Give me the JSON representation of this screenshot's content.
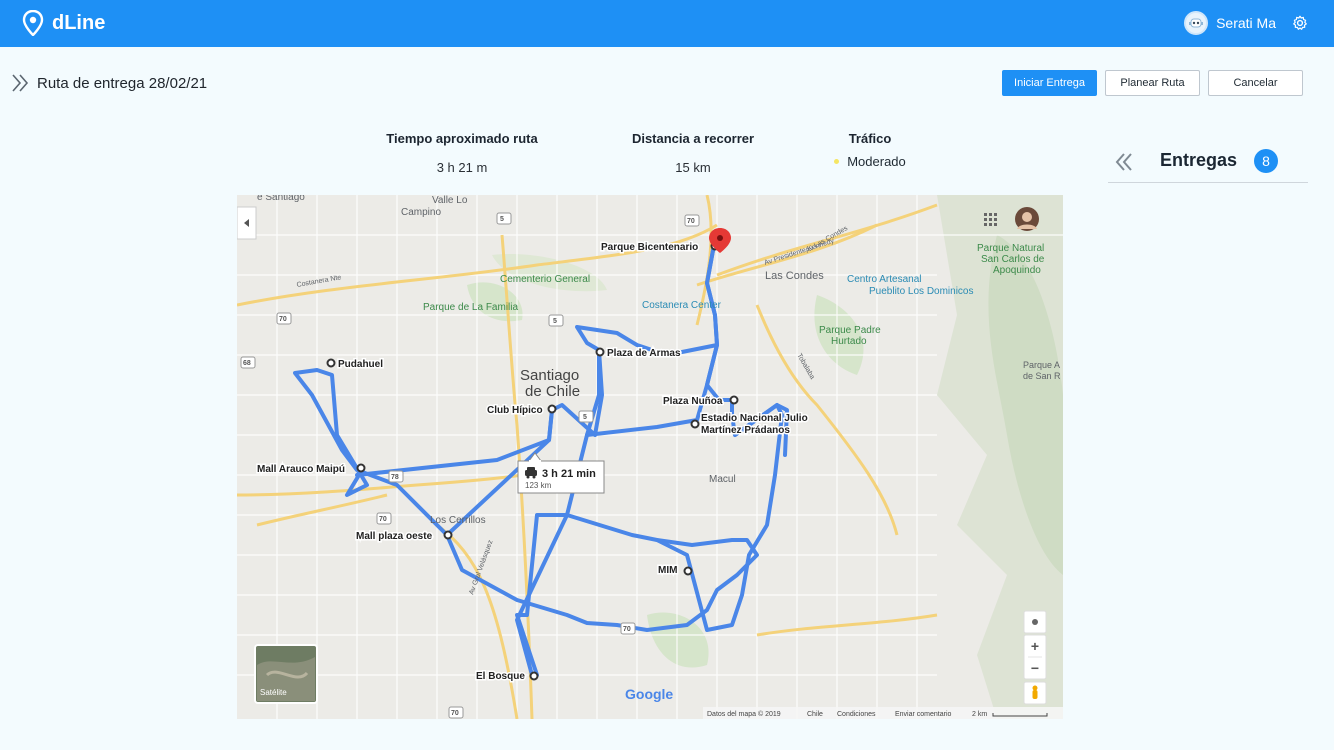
{
  "app": {
    "name": "dLine"
  },
  "user": {
    "name": "Serati Ma"
  },
  "page": {
    "title": "Ruta de entrega 28/02/21"
  },
  "actions": {
    "start": "Iniciar Entrega",
    "plan": "Planear Ruta",
    "cancel": "Cancelar"
  },
  "stats": {
    "time_label": "Tiempo aproximado ruta",
    "time_value": "3 h 21 m",
    "distance_label": "Distancia a recorrer",
    "distance_value": "15 km",
    "traffic_label": "Tráfico",
    "traffic_value": "Moderado"
  },
  "sidebar": {
    "title": "Entregas",
    "count": "8"
  },
  "map": {
    "route_badge_time": "3 h 21 min",
    "route_badge_distance": "123 km",
    "stops": [
      "Parque Bicentenario",
      "Plaza de Armas",
      "Pudahuel",
      "Club Hípico",
      "Plaza Nuñoa",
      "Estadio Nacional Julio",
      "Martínez Prádanos",
      "Mall Arauco Maipú",
      "Mall plaza oeste",
      "MIM",
      "El Bosque"
    ],
    "places": [
      "Valle Lo",
      "Campino",
      "Cementerio General",
      "Parque de La Familia",
      "Costanera Center",
      "Las Condes",
      "Centro Artesanal",
      "Pueblito Los Dominicos",
      "Parque Natural",
      "San Carlos de",
      "Apoquindo",
      "Parque Padre",
      "Hurtado",
      "Santiago",
      "de Chile",
      "Macul",
      "Los Cerrillos",
      "Av Presidente Kennedy",
      "Av Las Condes",
      "Costanera Nte",
      "Tobalaba",
      "Av Gral Velásquez",
      "Parque A",
      "de San R",
      "e Santiago"
    ],
    "satellite_label": "Satélite",
    "google_label": "Google",
    "footer": [
      "Datos del mapa © 2019",
      "Chile",
      "Condiciones",
      "Enviar comentario",
      "2 km"
    ],
    "route_shields": [
      "70",
      "5",
      "70",
      "5",
      "68",
      "78",
      "70",
      "70",
      "5",
      "70"
    ],
    "zoom_in": "+",
    "zoom_out": "−"
  },
  "colors": {
    "brand": "#1e90f5",
    "route": "#4a86e8",
    "traffic_dot": "#f5e663"
  },
  "icons": [
    "location-pin-icon",
    "robot-avatar-icon",
    "gear-icon",
    "double-chevron-right-icon",
    "double-chevron-left-icon",
    "car-icon",
    "apps-grid-icon",
    "pegman-icon",
    "my-location-icon"
  ]
}
